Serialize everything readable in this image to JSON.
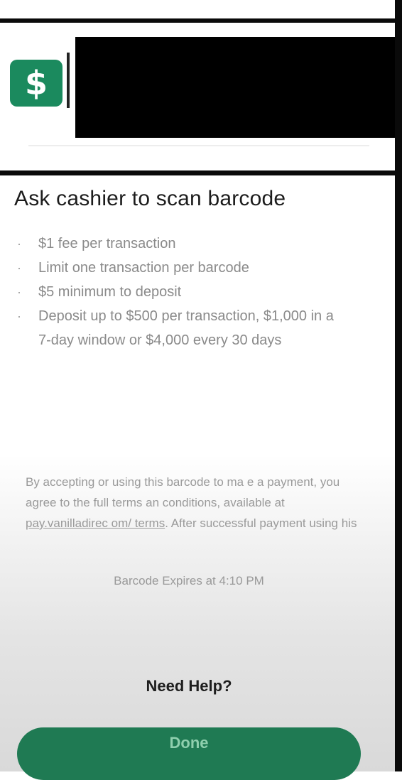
{
  "merchant": {
    "app_icon_glyph": "$",
    "app_icon_name": "cash-app-icon",
    "brand_color": "#1b8a5e"
  },
  "barcode_sheet": {
    "title": "Ask cashier to scan barcode",
    "bullets": [
      "$1 fee per transaction",
      "Limit one transaction per barcode",
      "$5 minimum to deposit",
      "Deposit up to $500 per transaction, $1,000 in a 7-day window or $4,000 every 30 days"
    ],
    "bullet_glyph": "·",
    "disclaimer": {
      "before_link": "By accepting or using this barcode to ma e a payment, you agree to the full terms an conditions, available at ",
      "link_text": "pay.vanilladirec om/ terms",
      "after_link": ". After successful payment using his"
    },
    "expiry_text": "Barcode Expires at 4:10 PM",
    "help_link": "Need Help?",
    "done_button": "Done",
    "button_color": "#1f7a53"
  }
}
